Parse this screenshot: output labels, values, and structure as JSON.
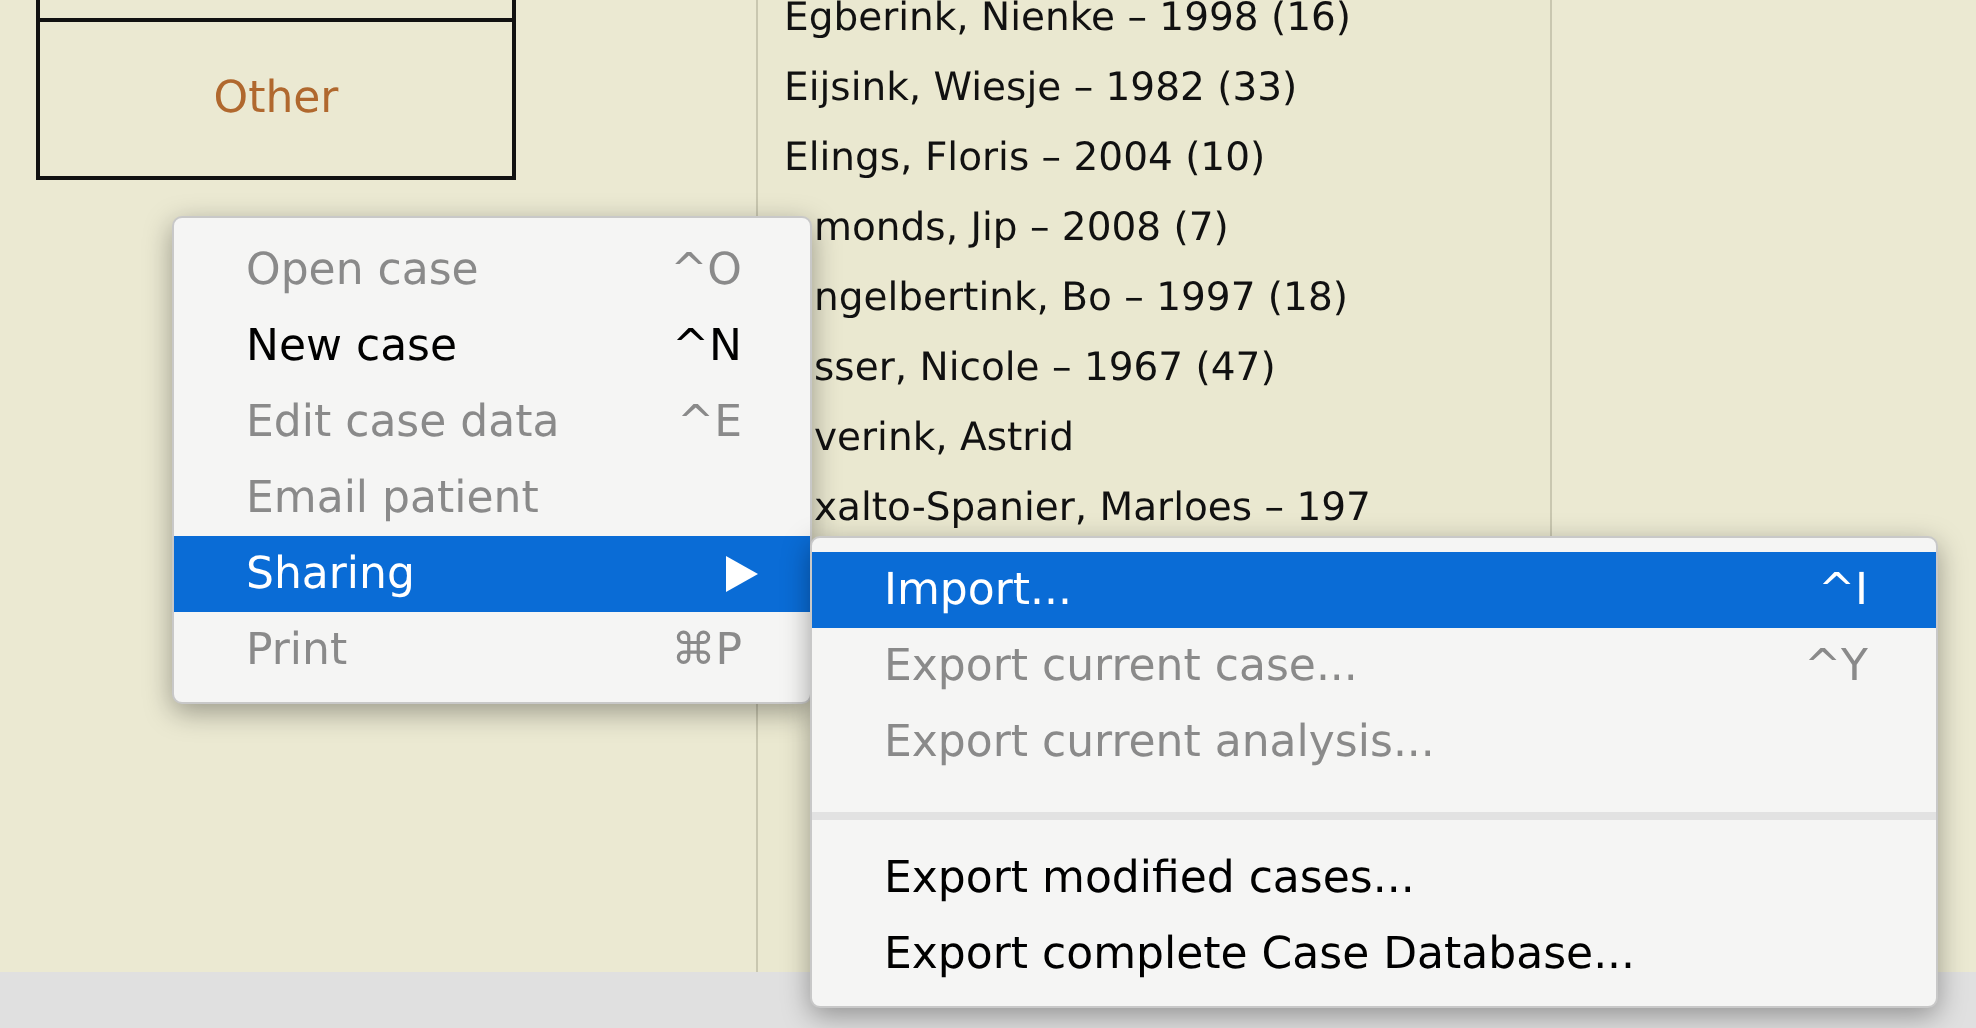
{
  "category_box": {
    "label": "Other"
  },
  "patient_list": [
    {
      "text": "Egberink, Nienke – 1998 (16)",
      "covered": false
    },
    {
      "text": "Eijsink, Wiesje – 1982 (33)",
      "covered": false
    },
    {
      "text": "Elings, Floris – 2004 (10)",
      "covered": false
    },
    {
      "text": "monds, Jip – 2008 (7)",
      "covered": true
    },
    {
      "text": "ngelbertink, Bo – 1997 (18)",
      "covered": true
    },
    {
      "text": "sser, Nicole – 1967 (47)",
      "covered": true
    },
    {
      "text": "verink, Astrid",
      "covered": true
    },
    {
      "text": "xalto-Spanier, Marloes – 197",
      "covered": true
    }
  ],
  "context_menu": {
    "items": [
      {
        "label": "Open case",
        "shortcut": "^O",
        "disabled": true,
        "selected": false,
        "submenu": false
      },
      {
        "label": "New case",
        "shortcut": "^N",
        "disabled": false,
        "selected": false,
        "submenu": false
      },
      {
        "label": "Edit case data",
        "shortcut": "^E",
        "disabled": true,
        "selected": false,
        "submenu": false
      },
      {
        "label": "Email patient",
        "disabled": true,
        "selected": false,
        "submenu": false
      },
      {
        "label": "Sharing",
        "disabled": false,
        "selected": true,
        "submenu": true
      },
      {
        "label": "Print",
        "shortcut": "⌘P",
        "disabled": true,
        "selected": false,
        "submenu": false
      }
    ]
  },
  "sharing_submenu": {
    "items": [
      {
        "kind": "item",
        "label": "Import...",
        "shortcut": "^I",
        "disabled": false,
        "selected": true
      },
      {
        "kind": "item",
        "label": "Export current case...",
        "shortcut": "^Y",
        "disabled": true,
        "selected": false
      },
      {
        "kind": "item",
        "label": "Export current analysis...",
        "disabled": true,
        "selected": false
      },
      {
        "kind": "separator"
      },
      {
        "kind": "item",
        "label": "Export modified cases...",
        "disabled": false,
        "selected": false
      },
      {
        "kind": "item",
        "label": "Export complete Case Database...",
        "disabled": false,
        "selected": false
      }
    ]
  }
}
